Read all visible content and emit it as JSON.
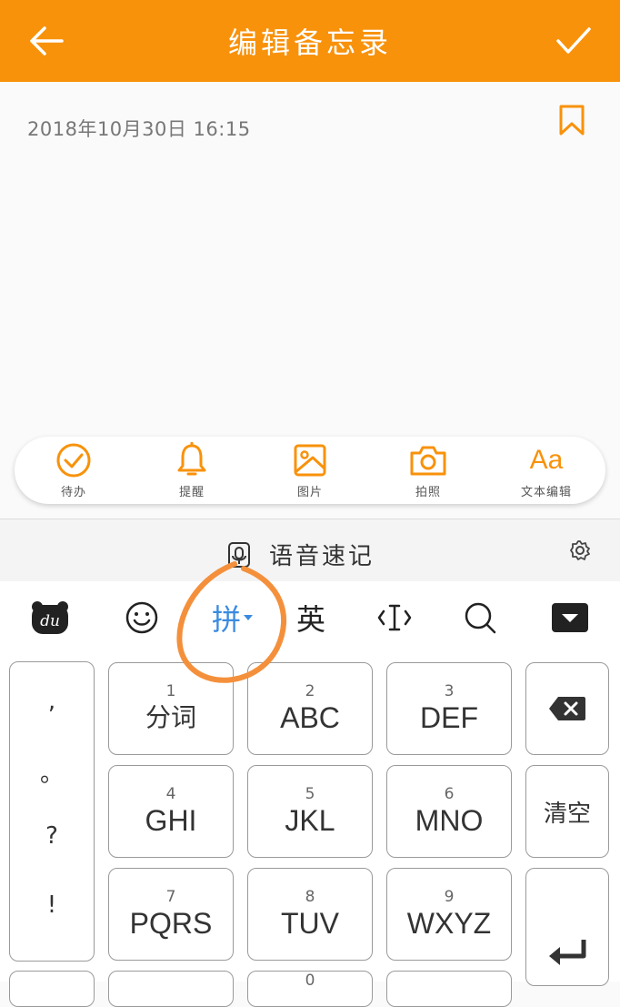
{
  "header": {
    "title": "编辑备忘录",
    "back_icon": "arrow-left-icon",
    "confirm_icon": "check-icon",
    "bg_color": "#f8920b"
  },
  "note": {
    "timestamp": "2018年10月30日  16:15",
    "bookmark_icon": "bookmark-icon"
  },
  "toolbar": {
    "items": [
      {
        "label": "待办",
        "icon": "check-circle-icon"
      },
      {
        "label": "提醒",
        "icon": "bell-icon"
      },
      {
        "label": "图片",
        "icon": "image-icon"
      },
      {
        "label": "拍照",
        "icon": "camera-icon"
      },
      {
        "label": "文本编辑",
        "icon": "text-format-icon",
        "glyph": "Aa"
      }
    ]
  },
  "voice_bar": {
    "label": "语音速记",
    "icon": "microphone-icon",
    "settings_icon": "gear-icon"
  },
  "keyboard": {
    "func_row": [
      {
        "name": "du-logo",
        "icon": "bear-logo-icon",
        "text": "du"
      },
      {
        "name": "emoji",
        "icon": "smiley-icon"
      },
      {
        "name": "pinyin",
        "text": "拼"
      },
      {
        "name": "english",
        "text": "英"
      },
      {
        "name": "cursor",
        "icon": "cursor-move-icon"
      },
      {
        "name": "search",
        "icon": "search-icon"
      },
      {
        "name": "hide",
        "icon": "keyboard-hide-icon"
      }
    ],
    "punct": [
      ",",
      "。",
      "?",
      "!"
    ],
    "keys": [
      {
        "num": "1",
        "main": "分词"
      },
      {
        "num": "2",
        "main": "ABC"
      },
      {
        "num": "3",
        "main": "DEF"
      },
      {
        "num": "4",
        "main": "GHI"
      },
      {
        "num": "5",
        "main": "JKL"
      },
      {
        "num": "6",
        "main": "MNO"
      },
      {
        "num": "7",
        "main": "PQRS"
      },
      {
        "num": "8",
        "main": "TUV"
      },
      {
        "num": "9",
        "main": "WXYZ"
      },
      {
        "num": "0",
        "main": ""
      }
    ],
    "backspace_icon": "backspace-icon",
    "clear_label": "清空",
    "enter_icon": "enter-icon",
    "accent_color": "#3a8be0"
  },
  "annotation": {
    "color": "#f4903b"
  }
}
